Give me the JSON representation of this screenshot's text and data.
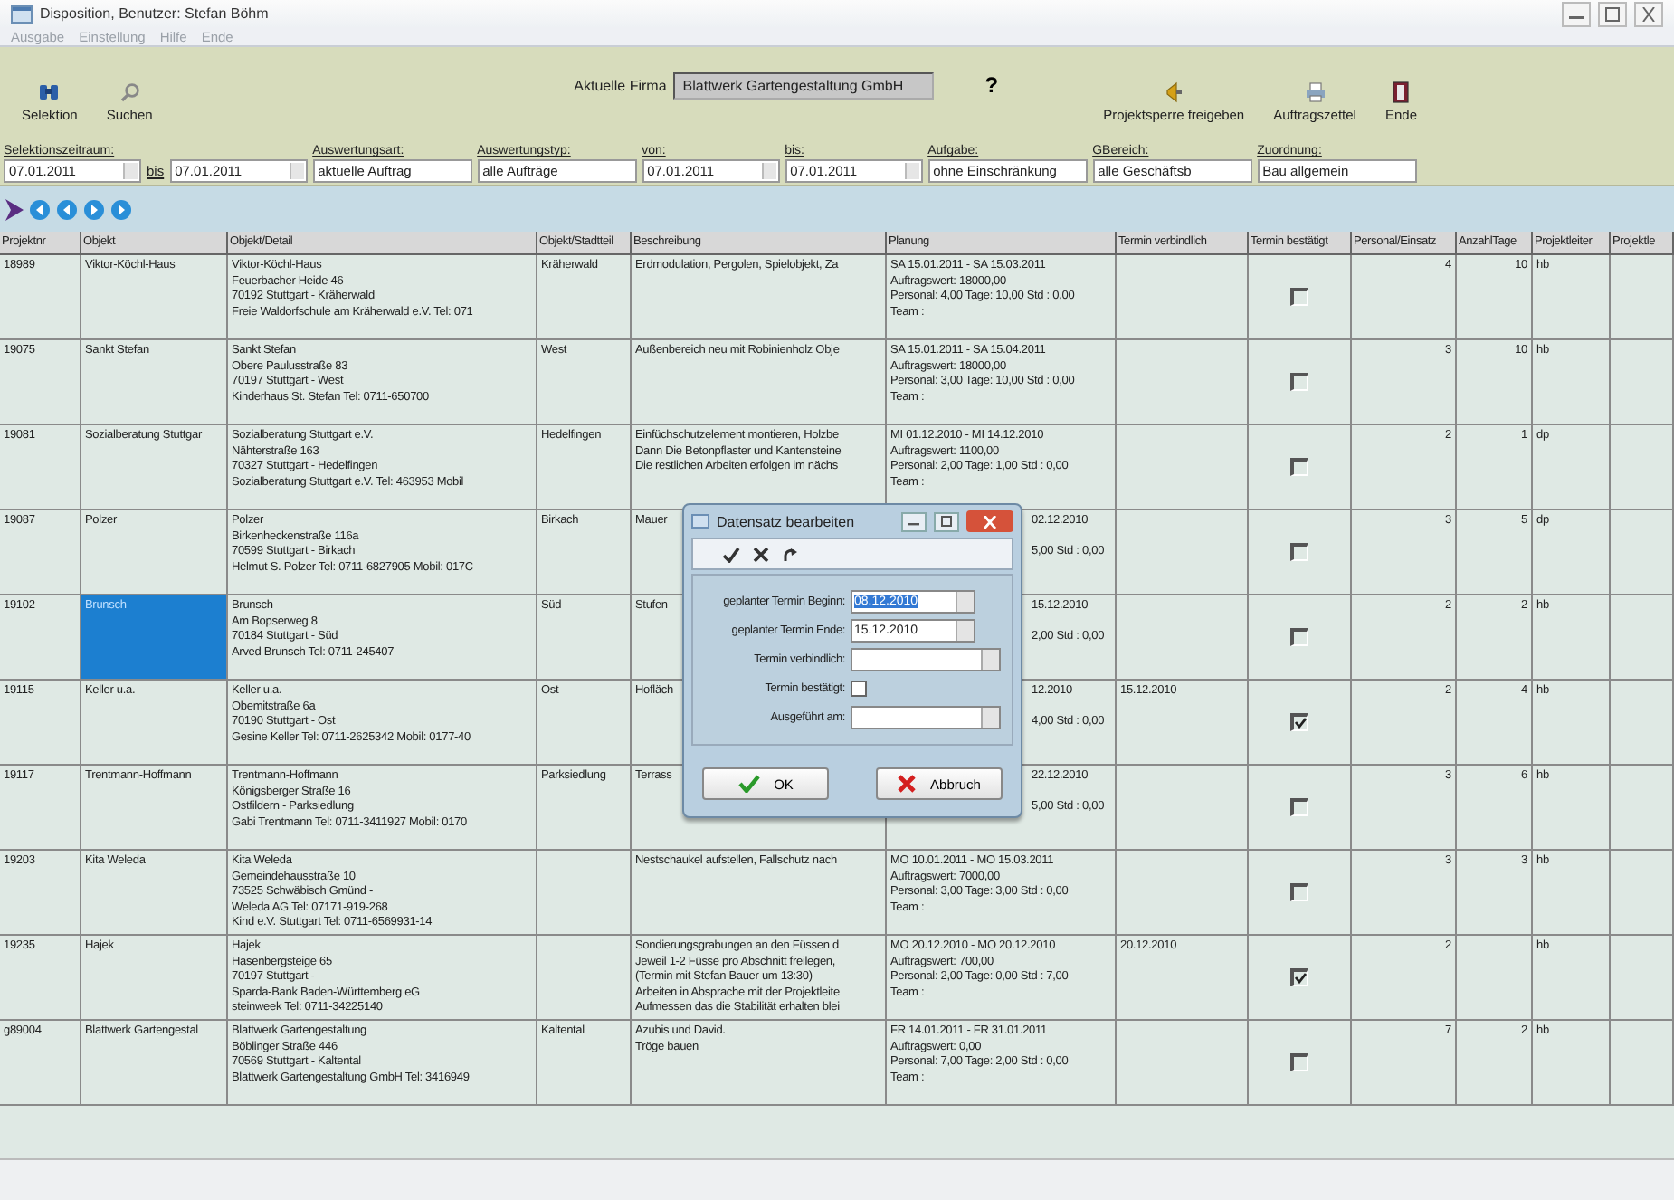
{
  "window": {
    "title": "Disposition, Benutzer: Stefan Böhm"
  },
  "menu": [
    {
      "label": "Ausgabe",
      "disabled": true
    },
    {
      "label": "Einstellung",
      "disabled": true
    },
    {
      "label": "Hilfe",
      "disabled": true
    },
    {
      "label": "Ende",
      "disabled": true
    }
  ],
  "toolbar": {
    "left": [
      {
        "label": "Selektion"
      },
      {
        "label": "Suchen"
      }
    ],
    "company_label": "Aktuelle Firma",
    "company": "Blattwerk Gartengestaltung GmbH",
    "help": "?",
    "right": [
      {
        "label": "Projektsperre freigeben"
      },
      {
        "label": "Auftragszettel"
      },
      {
        "label": "Ende"
      }
    ]
  },
  "filters": [
    {
      "label": "Selektionszeitraum:",
      "value": "07.01.2011",
      "kind": "date"
    },
    {
      "label": "bis",
      "kind": "link"
    },
    {
      "value": "07.01.2011",
      "kind": "date"
    },
    {
      "label": "Auswertungsart:",
      "value": "aktuelle Auftrag",
      "kind": "text"
    },
    {
      "label": "Auswertungstyp:",
      "value": "alle Aufträge",
      "kind": "text"
    },
    {
      "label": "von:",
      "value": "07.01.2011",
      "kind": "date"
    },
    {
      "label": "bis:",
      "value": "07.01.2011",
      "kind": "date"
    },
    {
      "label": "Aufgabe:",
      "value": "ohne Einschränkung",
      "kind": "text"
    },
    {
      "label": "GBereich:",
      "value": "alle Geschäftsb",
      "kind": "text"
    },
    {
      "label": "Zuordnung:",
      "value": "Bau allgemein",
      "kind": "text"
    }
  ],
  "table": {
    "columns": [
      "Projektnr",
      "Objekt",
      "Objekt/Detail",
      "Objekt/Stadtteil",
      "Beschreibung",
      "Planung",
      "Termin verbindlich",
      "Termin bestätigt",
      "Personal/Einsatz",
      "AnzahlTage",
      "Projektleiter",
      "Projektle"
    ],
    "rows": [
      {
        "nr": "18989",
        "objekt": "Viktor-Köchl-Haus",
        "selected": false,
        "detail": [
          "Viktor-Köchl-Haus",
          "Feuerbacher Heide 46",
          "70192 Stuttgart - Kräherwald",
          "Freie Waldorfschule am Kräherwald e.V. Tel: 071"
        ],
        "stadtteil": "Kräherwald",
        "beschreibung": [
          "Erdmodulation, Pergolen, Spielobjekt, Za"
        ],
        "covered": false,
        "planung": [
          "SA 15.01.2011 - SA 15.03.2011",
          "Auftragswert: 18000,00",
          "Personal: 4,00 Tage: 10,00 Std : 0,00",
          "Team :"
        ],
        "verbindlich": "",
        "confirmed": false,
        "personal": "4",
        "tage": "10",
        "leiter": "hb"
      },
      {
        "nr": "19075",
        "objekt": "Sankt Stefan",
        "selected": false,
        "detail": [
          "Sankt Stefan",
          "Obere Paulusstraße 83",
          "70197 Stuttgart - West",
          "Kinderhaus St. Stefan Tel: 0711-650700"
        ],
        "stadtteil": "West",
        "beschreibung": [
          "Außenbereich neu mit Robinienholz Obje"
        ],
        "covered": false,
        "planung": [
          "SA 15.01.2011 - SA 15.04.2011",
          "Auftragswert: 18000,00",
          "Personal: 3,00 Tage: 10,00 Std : 0,00",
          "Team :"
        ],
        "verbindlich": "",
        "confirmed": false,
        "personal": "3",
        "tage": "10",
        "leiter": "hb"
      },
      {
        "nr": "19081",
        "objekt": "Sozialberatung Stuttgar",
        "selected": false,
        "detail": [
          "Sozialberatung Stuttgart e.V.",
          "Nähterstraße 163",
          "70327 Stuttgart - Hedelfingen",
          "Sozialberatung Stuttgart e.V. Tel: 463953 Mobil"
        ],
        "stadtteil": "Hedelfingen",
        "beschreibung": [
          "Einfüchschutzelement montieren, Holzbe",
          "Dann Die Betonpflaster und Kantensteine",
          "Die restlichen Arbeiten erfolgen im nächs"
        ],
        "covered": false,
        "planung": [
          "MI 01.12.2010 - MI 14.12.2010",
          "Auftragswert: 1100,00",
          "Personal: 2,00 Tage: 1,00 Std : 0,00",
          "Team :"
        ],
        "verbindlich": "",
        "confirmed": false,
        "personal": "2",
        "tage": "1",
        "leiter": "dp"
      },
      {
        "nr": "19087",
        "objekt": "Polzer",
        "selected": false,
        "detail": [
          "Polzer",
          "Birkenheckenstraße 116a",
          "70599 Stuttgart - Birkach",
          "Helmut S. Polzer Tel: 0711-6827905 Mobil: 017C"
        ],
        "stadtteil": "Birkach",
        "beschreibung": [
          "Mauer"
        ],
        "covered": true,
        "planung": [
          "02.12.2010",
          "5,00 Std : 0,00"
        ],
        "verbindlich": "",
        "confirmed": false,
        "personal": "3",
        "tage": "5",
        "leiter": "dp"
      },
      {
        "nr": "19102",
        "objekt": "Brunsch",
        "selected": true,
        "detail": [
          "Brunsch",
          "Am Bopserweg 8",
          "70184 Stuttgart - Süd",
          "Arved Brunsch Tel: 0711-245407"
        ],
        "stadtteil": "Süd",
        "beschreibung": [
          "Stufen"
        ],
        "covered": true,
        "planung": [
          "15.12.2010",
          "2,00 Std : 0,00"
        ],
        "verbindlich": "",
        "confirmed": false,
        "personal": "2",
        "tage": "2",
        "leiter": "hb"
      },
      {
        "nr": "19115",
        "objekt": "Keller u.a.",
        "selected": false,
        "detail": [
          "Keller u.a.",
          "Obemitstraße 6a",
          "70190 Stuttgart - Ost",
          "Gesine Keller Tel: 0711-2625342 Mobil: 0177-40"
        ],
        "stadtteil": "Ost",
        "beschreibung": [
          "Hofläch"
        ],
        "covered": true,
        "planung": [
          "12.2010",
          "4,00 Std : 0,00"
        ],
        "verbindlich": "15.12.2010",
        "confirmed": true,
        "personal": "2",
        "tage": "4",
        "leiter": "hb"
      },
      {
        "nr": "19117",
        "objekt": "Trentmann-Hoffmann",
        "selected": false,
        "detail": [
          "Trentmann-Hoffmann",
          "Königsberger Straße 16",
          "Ostfildern - Parksiedlung",
          "Gabi Trentmann Tel: 0711-3411927 Mobil: 0170"
        ],
        "stadtteil": "Parksiedlung",
        "beschreibung": [
          "Terrass"
        ],
        "covered": true,
        "planung": [
          "22.12.2010",
          "5,00 Std : 0,00"
        ],
        "verbindlich": "",
        "confirmed": false,
        "personal": "3",
        "tage": "6",
        "leiter": "hb"
      },
      {
        "nr": "19203",
        "objekt": "Kita Weleda",
        "selected": false,
        "detail": [
          "Kita Weleda",
          "Gemeindehausstraße 10",
          "73525 Schwäbisch Gmünd -",
          "Weleda AG Tel: 07171-919-268",
          "Kind e.V. Stuttgart Tel: 0711-6569931-14"
        ],
        "stadtteil": "",
        "beschreibung": [
          "Nestschaukel aufstellen, Fallschutz nach"
        ],
        "covered": false,
        "planung": [
          "MO 10.01.2011 - MO 15.03.2011",
          "Auftragswert: 7000,00",
          "Personal: 3,00 Tage: 3,00 Std : 0,00",
          "Team :"
        ],
        "verbindlich": "",
        "confirmed": false,
        "personal": "3",
        "tage": "3",
        "leiter": "hb"
      },
      {
        "nr": "19235",
        "objekt": "Hajek",
        "selected": false,
        "detail": [
          "Hajek",
          "Hasenbergsteige 65",
          "70197 Stuttgart -",
          "Sparda-Bank Baden-Württemberg eG",
          "steinweek Tel: 0711-34225140"
        ],
        "stadtteil": "",
        "beschreibung": [
          "Sondierungsgrabungen an den Füssen d",
          "Jeweil 1-2 Füsse pro Abschnitt freilegen,",
          "(Termin mit Stefan Bauer um 13:30)",
          "Arbeiten in Absprache mit der Projektleite",
          "Aufmessen das die Stabilität erhalten blei"
        ],
        "covered": false,
        "planung": [
          "MO 20.12.2010 - MO 20.12.2010",
          "Auftragswert: 700,00",
          "Personal: 2,00 Tage: 0,00 Std : 7,00",
          "Team :"
        ],
        "verbindlich": "20.12.2010",
        "confirmed": true,
        "personal": "2",
        "tage": "",
        "leiter": "hb"
      },
      {
        "nr": "g89004",
        "objekt": "Blattwerk Gartengestal",
        "selected": false,
        "detail": [
          "Blattwerk Gartengestaltung",
          "Böblinger Straße 446",
          "70569 Stuttgart - Kaltental",
          "Blattwerk Gartengestaltung GmbH Tel: 3416949"
        ],
        "stadtteil": "Kaltental",
        "beschreibung": [
          "Azubis und David.",
          "Tröge bauen"
        ],
        "covered": false,
        "planung": [
          "FR 14.01.2011 - FR 31.01.2011",
          "Auftragswert: 0,00",
          "Personal: 7,00 Tage: 2,00 Std : 0,00",
          "Team :"
        ],
        "verbindlich": "",
        "confirmed": false,
        "personal": "7",
        "tage": "2",
        "leiter": "hb"
      }
    ]
  },
  "dialog": {
    "title": "Datensatz bearbeiten",
    "fields": [
      {
        "label": "geplanter Termin Beginn:",
        "value": "08.12.2010",
        "kind": "date",
        "highlighted": true
      },
      {
        "label": "geplanter Termin Ende:",
        "value": "15.12.2010",
        "kind": "date",
        "highlighted": false
      },
      {
        "label": "Termin verbindlich:",
        "kind": "combo"
      },
      {
        "label": "Termin bestätigt:",
        "kind": "check",
        "checked": false
      },
      {
        "label": "Ausgeführt am:",
        "kind": "combo"
      }
    ],
    "ok": "OK",
    "cancel": "Abbruch"
  }
}
